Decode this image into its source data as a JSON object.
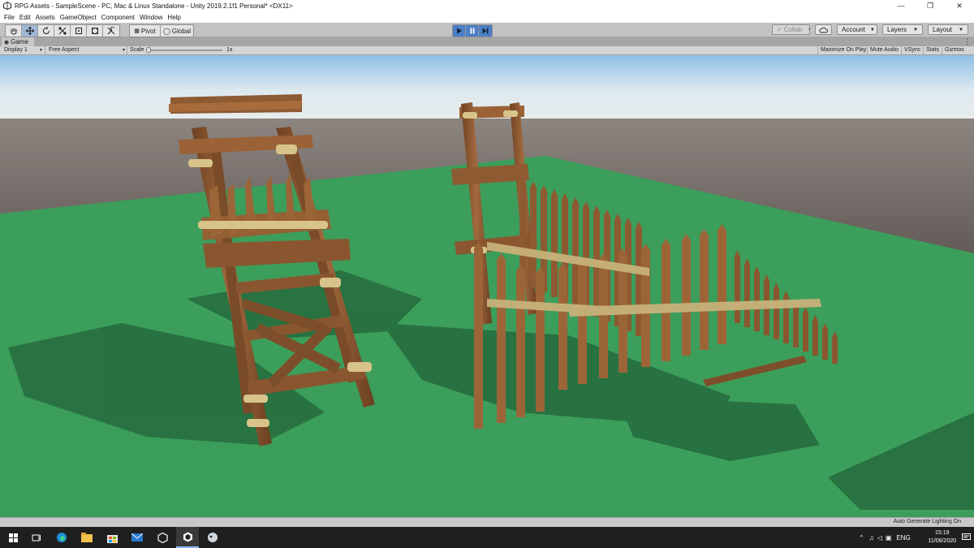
{
  "window": {
    "title": "RPG Assets - SampleScene - PC, Mac & Linux Standalone - Unity 2019.2.1f1 Personal* <DX11>",
    "controls": [
      "minimize",
      "restore",
      "close"
    ]
  },
  "menu": [
    "File",
    "Edit",
    "Assets",
    "GameObject",
    "Component",
    "Window",
    "Help"
  ],
  "toolbar": {
    "tools": [
      "hand-tool",
      "move-tool",
      "rotate-tool",
      "scale-tool",
      "rect-tool",
      "transform-tool",
      "custom-tool"
    ],
    "selected_tool": "move-tool",
    "pivot_label": "Pivot",
    "global_label": "Global",
    "play_controls": [
      "play",
      "pause",
      "step"
    ],
    "collab_label": "Collab",
    "account_label": "Account",
    "layers_label": "Layers",
    "layout_label": "Layout"
  },
  "game_tab": {
    "label": "Game"
  },
  "game_bar": {
    "display": "Display 1",
    "aspect": "Free Aspect",
    "scale_label": "Scale",
    "scale_value": "1x",
    "toggles": [
      "Maximize On Play",
      "Mute Audio",
      "VSync",
      "Stats",
      "Gizmos"
    ]
  },
  "status": {
    "text": "Auto Generate Lighting On"
  },
  "taskbar": {
    "apps": [
      "windows-start-icon",
      "task-view-icon",
      "edge-icon",
      "file-explorer-icon",
      "store-icon",
      "mail-icon",
      "unity-hub-icon",
      "unity-editor-icon",
      "app-icon"
    ],
    "language": "ENG",
    "time": "15:19",
    "date": "11/06/2020"
  },
  "colors": {
    "ground": "#3c9e5b",
    "sky_top": "#b9d7ef",
    "horizon": "#6e6660",
    "wood": "#8a5630",
    "rope": "#d8c48a",
    "play_active": "#4c7fc6"
  }
}
